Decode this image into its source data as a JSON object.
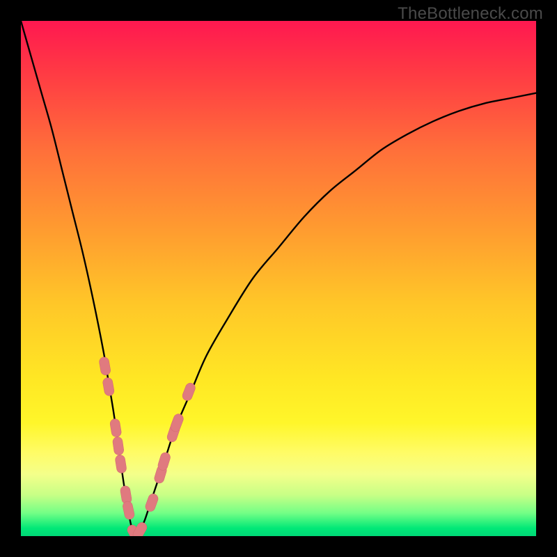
{
  "watermark": "TheBottleneck.com",
  "colors": {
    "frame": "#000000",
    "watermark": "#4a4a4a",
    "curve": "#000000",
    "marker_fill": "#e07a7f",
    "marker_stroke": "#d2696e",
    "gradient_stops": [
      {
        "offset": 0.0,
        "color": "#ff1850"
      },
      {
        "offset": 0.1,
        "color": "#ff3a44"
      },
      {
        "offset": 0.25,
        "color": "#ff6f3a"
      },
      {
        "offset": 0.4,
        "color": "#ff9a30"
      },
      {
        "offset": 0.55,
        "color": "#ffc728"
      },
      {
        "offset": 0.7,
        "color": "#ffe824"
      },
      {
        "offset": 0.78,
        "color": "#fff62a"
      },
      {
        "offset": 0.84,
        "color": "#fffc68"
      },
      {
        "offset": 0.88,
        "color": "#f4ff8a"
      },
      {
        "offset": 0.92,
        "color": "#c8ff86"
      },
      {
        "offset": 0.955,
        "color": "#74ff86"
      },
      {
        "offset": 0.985,
        "color": "#00e877"
      },
      {
        "offset": 1.0,
        "color": "#00d877"
      }
    ]
  },
  "chart_data": {
    "type": "line",
    "title": "",
    "xlabel": "",
    "ylabel": "",
    "xlim": [
      0,
      100
    ],
    "ylim": [
      0,
      100
    ],
    "x_min_at": 22,
    "series": [
      {
        "name": "bottleneck-curve",
        "x": [
          0,
          2,
          4,
          6,
          8,
          10,
          12,
          14,
          16,
          17,
          18,
          19,
          20,
          21,
          22,
          23,
          24,
          25,
          26,
          28,
          30,
          33,
          36,
          40,
          45,
          50,
          55,
          60,
          65,
          70,
          75,
          80,
          85,
          90,
          95,
          100
        ],
        "y": [
          100,
          93,
          86,
          79,
          71,
          63,
          55,
          46,
          36,
          30,
          24,
          17,
          10,
          4,
          0,
          1,
          3,
          6,
          9,
          15,
          21,
          28,
          35,
          42,
          50,
          56,
          62,
          67,
          71,
          75,
          78,
          80.5,
          82.5,
          84,
          85,
          86
        ]
      }
    ],
    "markers": {
      "name": "highlighted-points",
      "points": [
        {
          "x": 16.3,
          "y": 33
        },
        {
          "x": 17.0,
          "y": 29
        },
        {
          "x": 18.4,
          "y": 21
        },
        {
          "x": 18.9,
          "y": 17.5
        },
        {
          "x": 19.4,
          "y": 14
        },
        {
          "x": 20.4,
          "y": 8
        },
        {
          "x": 20.9,
          "y": 5
        },
        {
          "x": 22.0,
          "y": 0.5
        },
        {
          "x": 23.1,
          "y": 1
        },
        {
          "x": 25.4,
          "y": 6.5
        },
        {
          "x": 27.1,
          "y": 12
        },
        {
          "x": 27.8,
          "y": 14.5
        },
        {
          "x": 29.6,
          "y": 20
        },
        {
          "x": 30.3,
          "y": 22
        },
        {
          "x": 32.6,
          "y": 28
        }
      ]
    }
  }
}
